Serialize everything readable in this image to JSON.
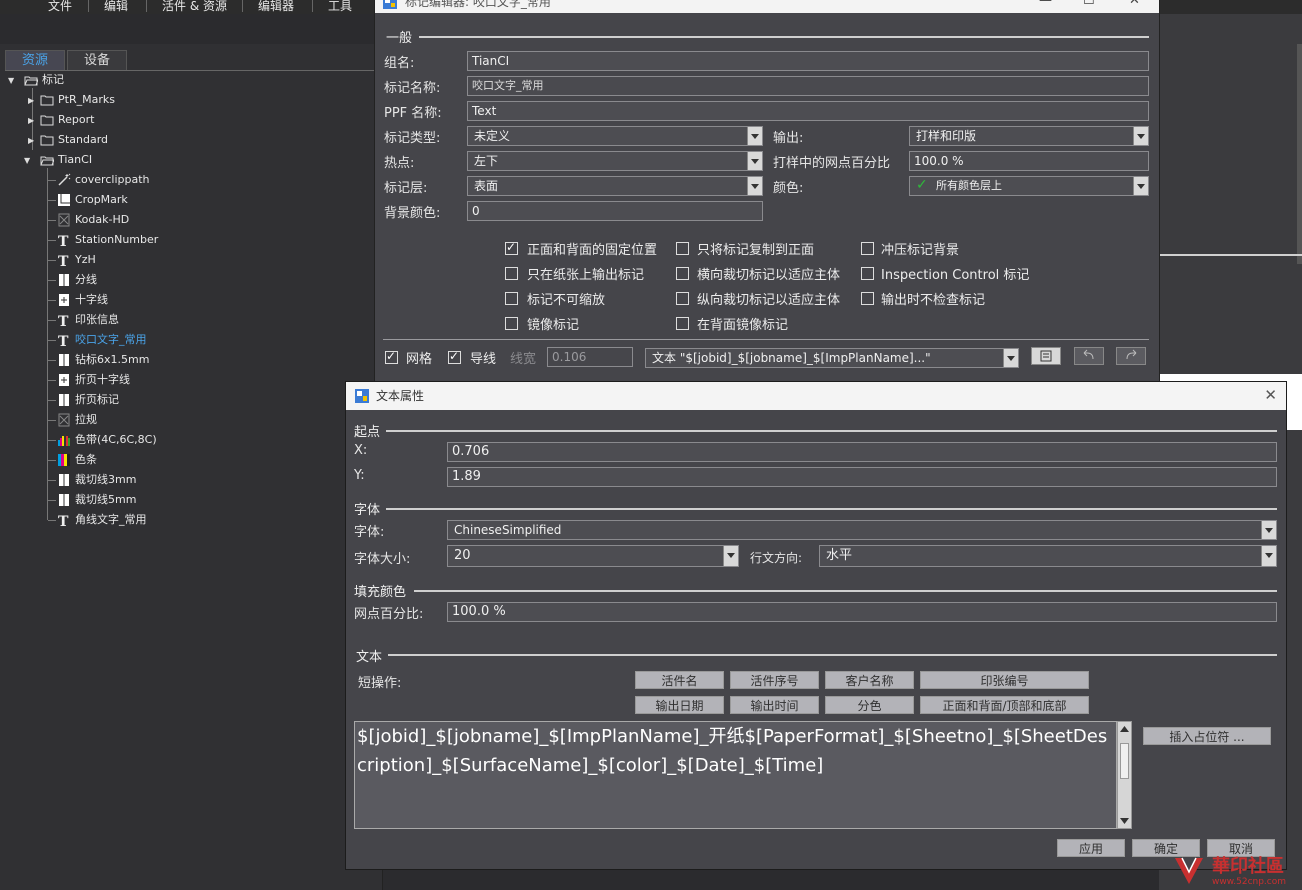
{
  "menubar": {
    "items": [
      "文件",
      "编辑",
      "活件 & 资源",
      "编辑器",
      "工具"
    ]
  },
  "left_panel": {
    "tabs": [
      "资源",
      "设备"
    ],
    "tree": {
      "root": "标记",
      "folders": [
        "PtR_Marks",
        "Report",
        "Standard",
        "TianCI"
      ],
      "tianci_children": [
        {
          "label": "coverclippath",
          "icon": "wand-icon"
        },
        {
          "label": "CropMark",
          "icon": "crop-mark-icon"
        },
        {
          "label": "Kodak-HD",
          "icon": "image-icon"
        },
        {
          "label": "StationNumber",
          "icon": "text-icon"
        },
        {
          "label": "YzH",
          "icon": "text-icon"
        },
        {
          "label": "分线",
          "icon": "mark-icon"
        },
        {
          "label": "十字线",
          "icon": "cross-mark-icon"
        },
        {
          "label": "印张信息",
          "icon": "text-icon"
        },
        {
          "label": "咬口文字_常用",
          "icon": "text-icon",
          "selected": true
        },
        {
          "label": "钻标6x1.5mm",
          "icon": "mark-icon"
        },
        {
          "label": "折页十字线",
          "icon": "cross-mark-icon"
        },
        {
          "label": "折页标记",
          "icon": "mark-icon"
        },
        {
          "label": "拉规",
          "icon": "image-icon"
        },
        {
          "label": "色带(4C,6C,8C)",
          "icon": "color-bar-icon"
        },
        {
          "label": "色条",
          "icon": "color-strip-icon"
        },
        {
          "label": "裁切线3mm",
          "icon": "mark-icon"
        },
        {
          "label": "裁切线5mm",
          "icon": "mark-icon"
        },
        {
          "label": "角线文字_常用",
          "icon": "text-icon"
        }
      ]
    }
  },
  "editor": {
    "title": "标记编辑器: 咬口文字_常用",
    "section_general": "一般",
    "group_name_label": "组名:",
    "group_name_value": "TianCI",
    "mark_name_label": "标记名称:",
    "mark_name_value": "咬口文字_常用",
    "ppf_label": "PPF 名称:",
    "ppf_value": "Text",
    "mark_type_label": "标记类型:",
    "mark_type_value": "未定义",
    "output_label": "输出:",
    "output_value": "打样和印版",
    "hotspot_label": "热点:",
    "hotspot_value": "左下",
    "proof_dot_label": "打样中的网点百分比",
    "proof_dot_value": "100.0 %",
    "layer_label": "标记层:",
    "layer_value": "表面",
    "color_label": "颜色:",
    "color_value": "所有颜色层上",
    "bg_color_label": "背景颜色:",
    "bg_color_value": "0",
    "checkboxes": [
      {
        "label": "正面和背面的固定位置",
        "checked": true
      },
      {
        "label": "只将标记复制到正面",
        "checked": false
      },
      {
        "label": "冲压标记背景",
        "checked": false
      },
      {
        "label": "只在纸张上输出标记",
        "checked": false
      },
      {
        "label": "横向裁切标记以适应主体",
        "checked": false
      },
      {
        "label": "Inspection Control 标记",
        "checked": false
      },
      {
        "label": "标记不可缩放",
        "checked": false
      },
      {
        "label": "纵向裁切标记以适应主体",
        "checked": false
      },
      {
        "label": "输出时不检查标记",
        "checked": false
      },
      {
        "label": "镜像标记",
        "checked": false
      },
      {
        "label": "在背面镜像标记",
        "checked": false
      }
    ],
    "grid_label": "网格",
    "guide_label": "导线",
    "line_width_label": "线宽",
    "line_width_value": "0.106",
    "object_select_value": "文本 \"$[jobid]_$[jobname]_$[ImpPlanName]...\""
  },
  "dialog": {
    "title": "文本属性",
    "section_origin": "起点",
    "x_label": "X:",
    "x_value": "0.706",
    "y_label": "Y:",
    "y_value": "1.89",
    "section_font": "字体",
    "font_label": "字体:",
    "font_value": "ChineseSimplified",
    "font_size_label": "字体大小:",
    "font_size_value": "20",
    "direction_label": "行文方向:",
    "direction_value": "水平",
    "section_fill": "填充颜色",
    "dot_label": "网点百分比:",
    "dot_value": "100.0 %",
    "section_text": "文本",
    "shortcut_label": "短操作:",
    "shortcut_buttons_row1": [
      "活件名",
      "活件序号",
      "客户名称",
      "印张编号"
    ],
    "shortcut_buttons_row2": [
      "输出日期",
      "输出时间",
      "分色",
      "正面和背面/顶部和底部"
    ],
    "text_content": "$[jobid]_$[jobname]_$[ImpPlanName]_开纸$[PaperFormat]_$[Sheetno]_$[SheetDescription]_$[SurfaceName]_$[color]_$[Date]_$[Time]",
    "insert_placeholder_label": "插入占位符 ...",
    "apply_label": "应用",
    "ok_label": "确定",
    "cancel_label": "取消"
  },
  "watermark": {
    "line1": "華印社區",
    "line2": "www.52cnp.com"
  }
}
